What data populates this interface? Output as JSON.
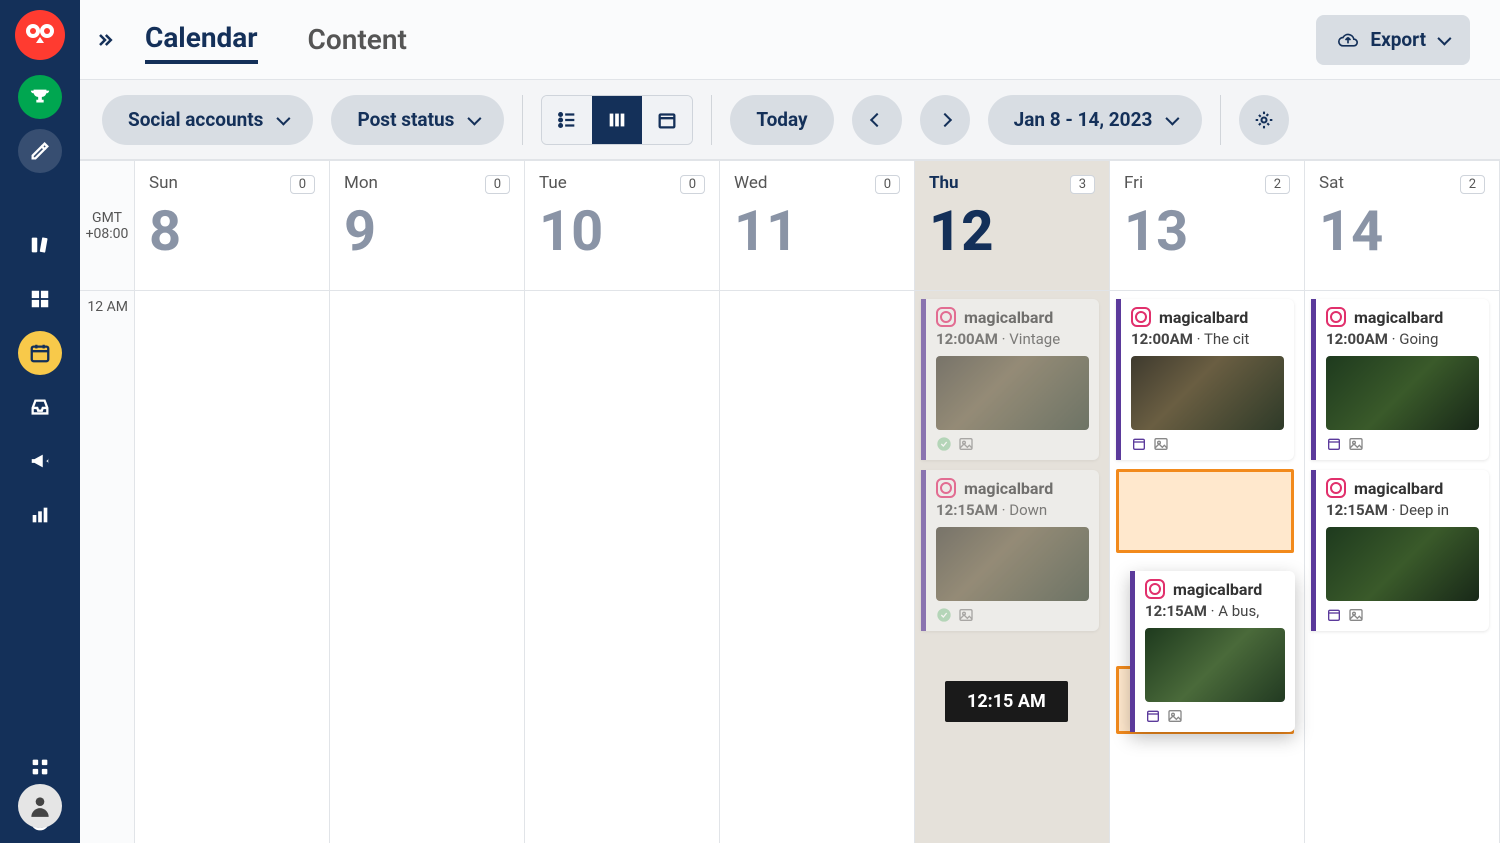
{
  "nav": {
    "tabs": {
      "calendar": "Calendar",
      "content": "Content"
    },
    "export_label": "Export"
  },
  "toolbar": {
    "social_accounts_label": "Social accounts",
    "post_status_label": "Post status",
    "today_label": "Today",
    "date_range_label": "Jan 8 - 14, 2023",
    "view_mode": "week"
  },
  "timezone": {
    "label": "GMT",
    "offset": "+08:00"
  },
  "time_labels": [
    "12 AM"
  ],
  "days": [
    {
      "name": "Sun",
      "num": "8",
      "count": "0",
      "today": false,
      "posts": []
    },
    {
      "name": "Mon",
      "num": "9",
      "count": "0",
      "today": false,
      "posts": []
    },
    {
      "name": "Tue",
      "num": "10",
      "count": "0",
      "today": false,
      "posts": []
    },
    {
      "name": "Wed",
      "num": "11",
      "count": "0",
      "today": false,
      "posts": []
    },
    {
      "name": "Thu",
      "num": "12",
      "count": "3",
      "today": true,
      "posts": [
        {
          "account": "magicalbard",
          "time": "12:00AM",
          "caption": "Vintage",
          "past": true,
          "status": "posted",
          "has_image": true
        },
        {
          "account": "magicalbard",
          "time": "12:15AM",
          "caption": "Down",
          "past": true,
          "status": "posted",
          "has_image": true
        }
      ]
    },
    {
      "name": "Fri",
      "num": "13",
      "count": "2",
      "today": false,
      "posts": [
        {
          "account": "magicalbard",
          "time": "12:00AM",
          "caption": "The cit",
          "past": false,
          "status": "scheduled",
          "has_image": true
        }
      ]
    },
    {
      "name": "Sat",
      "num": "14",
      "count": "2",
      "today": false,
      "posts": [
        {
          "account": "magicalbard",
          "time": "12:00AM",
          "caption": "Going",
          "past": false,
          "status": "scheduled",
          "has_image": true
        },
        {
          "account": "magicalbard",
          "time": "12:15AM",
          "caption": "Deep in",
          "past": false,
          "status": "scheduled",
          "has_image": true
        }
      ]
    }
  ],
  "dragging_post": {
    "account": "magicalbard",
    "time": "12:15AM",
    "caption": "A bus,",
    "status": "scheduled",
    "has_image": true
  },
  "drag_tooltip": "12:15 AM",
  "colors": {
    "sidebar_bg": "#143059",
    "pill_bg": "#d8dde3",
    "accent_purple": "#5b3a9b",
    "accent_orange": "#f28a1c",
    "accent_pink": "#e1306c"
  }
}
